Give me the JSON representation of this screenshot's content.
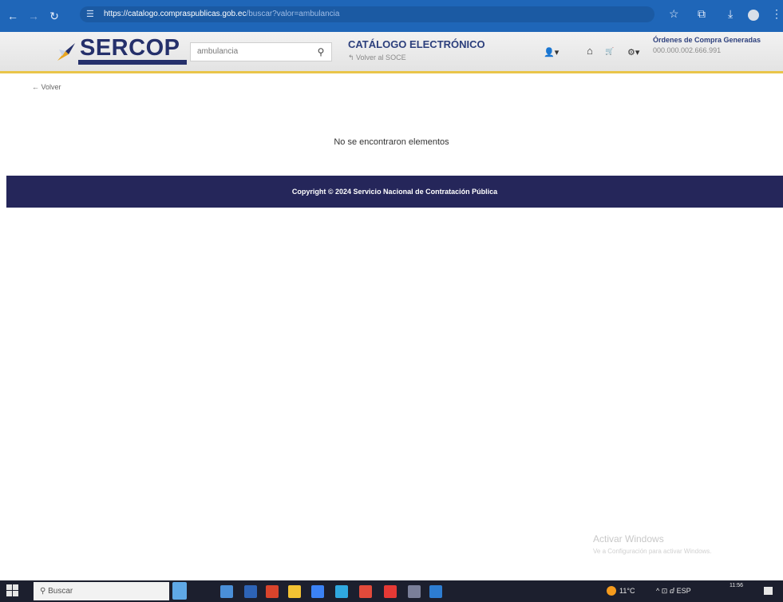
{
  "browser": {
    "url_domain": "https://catalogo.compraspublicas.gob.ec",
    "url_rest": "/buscar?valor=ambulancia",
    "back_glyph": "←",
    "forward_glyph": "→",
    "reload_glyph": "↻",
    "star_glyph": "☆",
    "extension_glyph": "⧉",
    "download_glyph": "⤓",
    "menu_glyph": "⋮"
  },
  "header": {
    "logo_text": "SERCOP",
    "search_value": "ambulancia",
    "search_icon": "search-icon",
    "catalog_title": "CATÁLOGO ELECTRÓNICO",
    "catalog_subtitle": "↰ Volver al SOCE",
    "orders_title": "Órdenes de Compra Generadas",
    "orders_number": "000.000.002.666.991",
    "icons": {
      "user": "👤▾",
      "home": "⌂",
      "cart": "🛒",
      "settings": "⚙▾"
    }
  },
  "content": {
    "back_link": "← Volver",
    "empty_message": "No se encontraron elementos"
  },
  "footer": {
    "copyright": "Copyright © 2024 Servicio Nacional de Contratación Pública"
  },
  "watermark": {
    "title": "Activar Windows",
    "subtitle": "Ve a Configuración para activar Windows."
  },
  "taskbar": {
    "search_placeholder": "Buscar",
    "temperature": "11°C",
    "tray_text": "^ ⊡ ⅆ ESP",
    "time": "11:56",
    "app_colors": [
      "#4a8fd8",
      "#2d63b6",
      "#d9442c",
      "#f2c233",
      "#3b82f6",
      "#2fa8e0",
      "#e24a3b",
      "#e53935",
      "#7a7f99",
      "#2d7dd2"
    ]
  }
}
